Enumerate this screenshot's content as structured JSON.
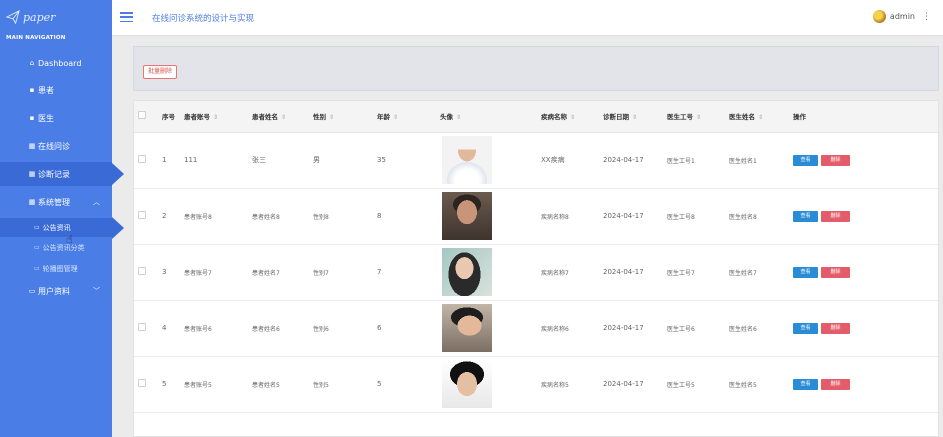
{
  "sidebar": {
    "logo_text": "paper",
    "section_label": "MAIN NAVIGATION",
    "items": [
      {
        "label": "Dashboard",
        "icon": "home-icon"
      },
      {
        "label": "患者",
        "icon": "doc-icon"
      },
      {
        "label": "医生",
        "icon": "doc-icon"
      },
      {
        "label": "在线问诊",
        "icon": "grid-icon"
      },
      {
        "label": "诊断记录",
        "icon": "grid-icon"
      },
      {
        "label": "系统管理",
        "icon": "grid-icon"
      },
      {
        "label": "用户资料",
        "icon": "card-icon"
      }
    ],
    "sub_items": [
      {
        "label": "公告资讯",
        "icon": "folder-icon"
      },
      {
        "label": "公告资讯分类",
        "icon": "folder-icon"
      },
      {
        "label": "轮播图管理",
        "icon": "folder-icon"
      }
    ]
  },
  "header": {
    "title": "在线问诊系统的设计与实现",
    "user_name": "admin"
  },
  "toolbar": {
    "batch_delete_label": "批量删除"
  },
  "table": {
    "columns": [
      "序号",
      "患者账号",
      "患者姓名",
      "性别",
      "年龄",
      "头像",
      "疾病名称",
      "诊断日期",
      "医生工号",
      "医生姓名",
      "操作"
    ],
    "sort_symbol": "⇕",
    "view_label": "查看",
    "delete_label": "删除",
    "rows": [
      {
        "index": "1",
        "account": "111",
        "name": "张三",
        "gender": "男",
        "age": "35",
        "disease": "XX疾病",
        "date": "2024-04-17",
        "doctor_id": "医生工号1",
        "doctor_name": "医生姓名1"
      },
      {
        "index": "2",
        "account": "患者账号8",
        "name": "患者姓名8",
        "gender": "性别8",
        "age": "8",
        "disease": "疾病名称8",
        "date": "2024-04-17",
        "doctor_id": "医生工号8",
        "doctor_name": "医生姓名8"
      },
      {
        "index": "3",
        "account": "患者账号7",
        "name": "患者姓名7",
        "gender": "性别7",
        "age": "7",
        "disease": "疾病名称7",
        "date": "2024-04-17",
        "doctor_id": "医生工号7",
        "doctor_name": "医生姓名7"
      },
      {
        "index": "4",
        "account": "患者账号6",
        "name": "患者姓名6",
        "gender": "性别6",
        "age": "6",
        "disease": "疾病名称6",
        "date": "2024-04-17",
        "doctor_id": "医生工号6",
        "doctor_name": "医生姓名6"
      },
      {
        "index": "5",
        "account": "患者账号5",
        "name": "患者姓名5",
        "gender": "性别5",
        "age": "5",
        "disease": "疾病名称5",
        "date": "2024-04-17",
        "doctor_id": "医生工号5",
        "doctor_name": "医生姓名5"
      }
    ]
  },
  "colors": {
    "sidebar_bg": "#4a7ee6",
    "sidebar_active": "#3a6ad6",
    "accent": "#4a7ee6",
    "view_button": "#2a8bd6",
    "delete_button": "#e45c6b"
  }
}
